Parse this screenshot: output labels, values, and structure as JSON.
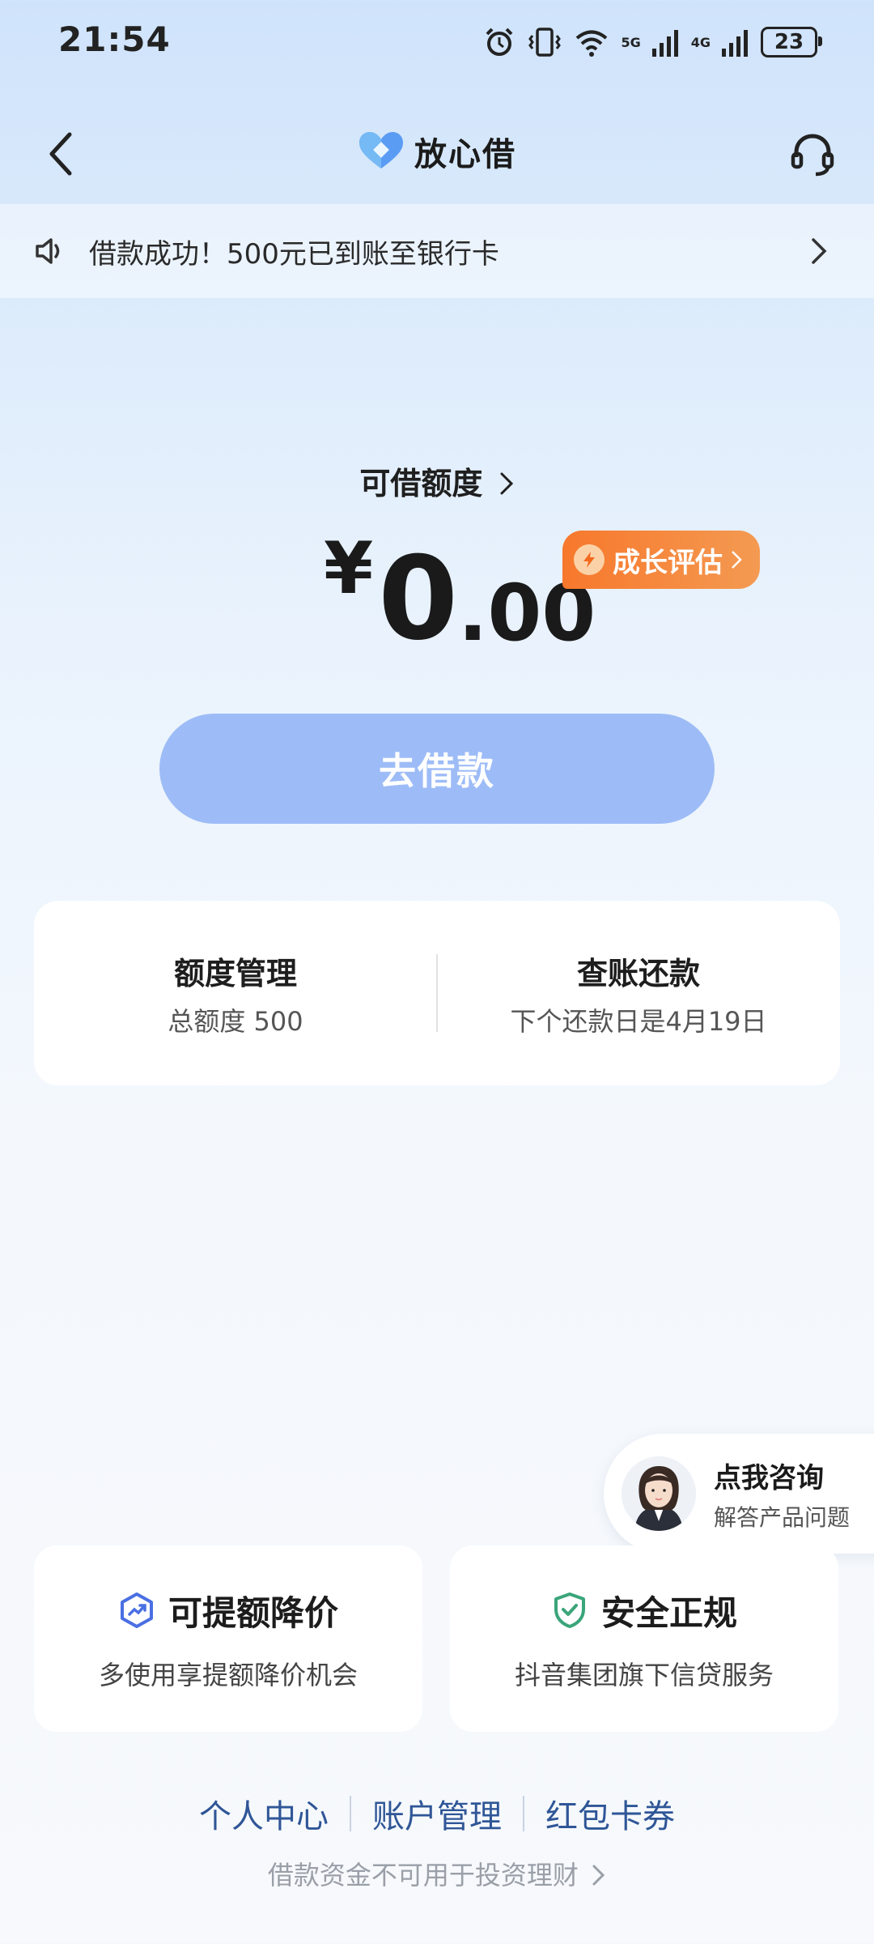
{
  "status_bar": {
    "time": "21:54",
    "network_5g": "5G",
    "network_4g": "4G",
    "battery": "23"
  },
  "header": {
    "app_name": "放心借",
    "back_icon": "chevron-left-icon",
    "support_icon": "headset-icon"
  },
  "notice": {
    "icon": "speaker-icon",
    "text": "借款成功！500元已到账至银行卡"
  },
  "credit": {
    "label": "可借额度",
    "currency": "¥",
    "amount_int": "0",
    "amount_dec": ".00",
    "badge": "成长评估"
  },
  "borrow_button": "去借款",
  "card": {
    "left": {
      "title": "额度管理",
      "sub": "总额度 500"
    },
    "right": {
      "title": "查账还款",
      "sub": "下个还款日是4月19日"
    }
  },
  "consult": {
    "title": "点我咨询",
    "sub": "解答产品问题"
  },
  "features": [
    {
      "title": "可提额降价",
      "sub": "多使用享提额降价机会",
      "icon": "trend-up-shield-icon",
      "color": "#4a6fe3"
    },
    {
      "title": "安全正规",
      "sub": "抖音集团旗下信贷服务",
      "icon": "check-shield-icon",
      "color": "#3aa57a"
    }
  ],
  "footer": {
    "links": [
      "个人中心",
      "账户管理",
      "红包卡券"
    ],
    "disclaimer": "借款资金不可用于投资理财"
  },
  "colors": {
    "accent": "#9dbcf7",
    "badge": "#f7782c",
    "link": "#2f5697"
  }
}
